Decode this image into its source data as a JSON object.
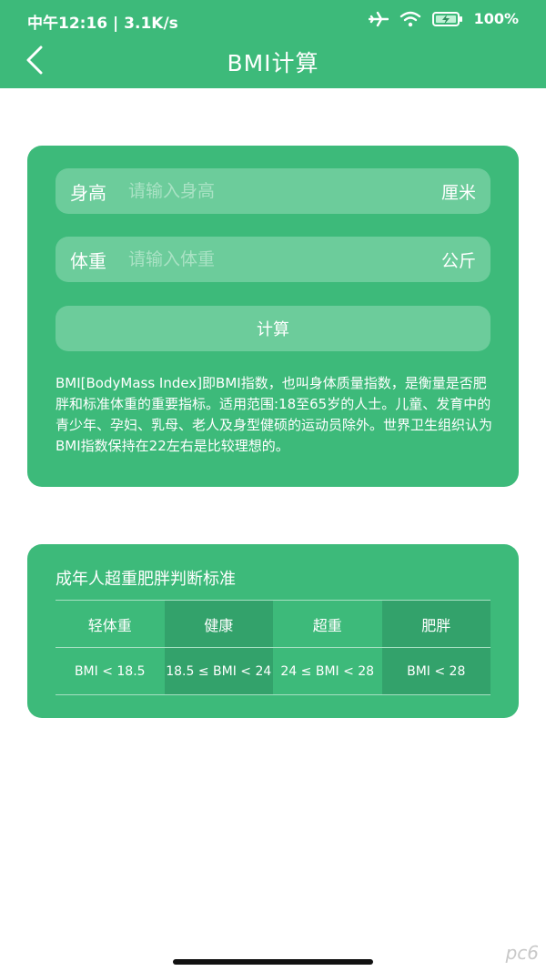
{
  "status_bar": {
    "time_speed": "中午12:16 | 3.1K/s",
    "battery": "100%"
  },
  "nav": {
    "title": "BMI计算"
  },
  "form": {
    "height_label": "身高",
    "height_placeholder": "请输入身高",
    "height_value": "",
    "height_unit": "厘米",
    "weight_label": "体重",
    "weight_placeholder": "请输入体重",
    "weight_value": "",
    "weight_unit": "公斤",
    "calc_label": "计算",
    "description": "BMI[BodyMass Index]即BMI指数，也叫身体质量指数，是衡量是否肥胖和标准体重的重要指标。适用范围:18至65岁的人士。儿童、发育中的青少年、孕妇、乳母、老人及身型健硕的运动员除外。世界卫生组织认为BMI指数保持在22左右是比较理想的。"
  },
  "standard": {
    "title": "成年人超重肥胖判断标准",
    "headers": [
      "轻体重",
      "健康",
      "超重",
      "肥胖"
    ],
    "values": [
      "BMI < 18.5",
      "18.5 ≤ BMI < 24",
      "24 ≤ BMI < 28",
      "BMI < 28"
    ]
  },
  "watermark": "pc6",
  "colors": {
    "primary": "#3dba7a",
    "field": "#6ccc9b",
    "alt_column": "#33a26b"
  },
  "icons": {
    "back": "chevron-left-icon",
    "airplane": "airplane-icon",
    "wifi": "wifi-icon",
    "battery": "battery-charging-icon"
  }
}
